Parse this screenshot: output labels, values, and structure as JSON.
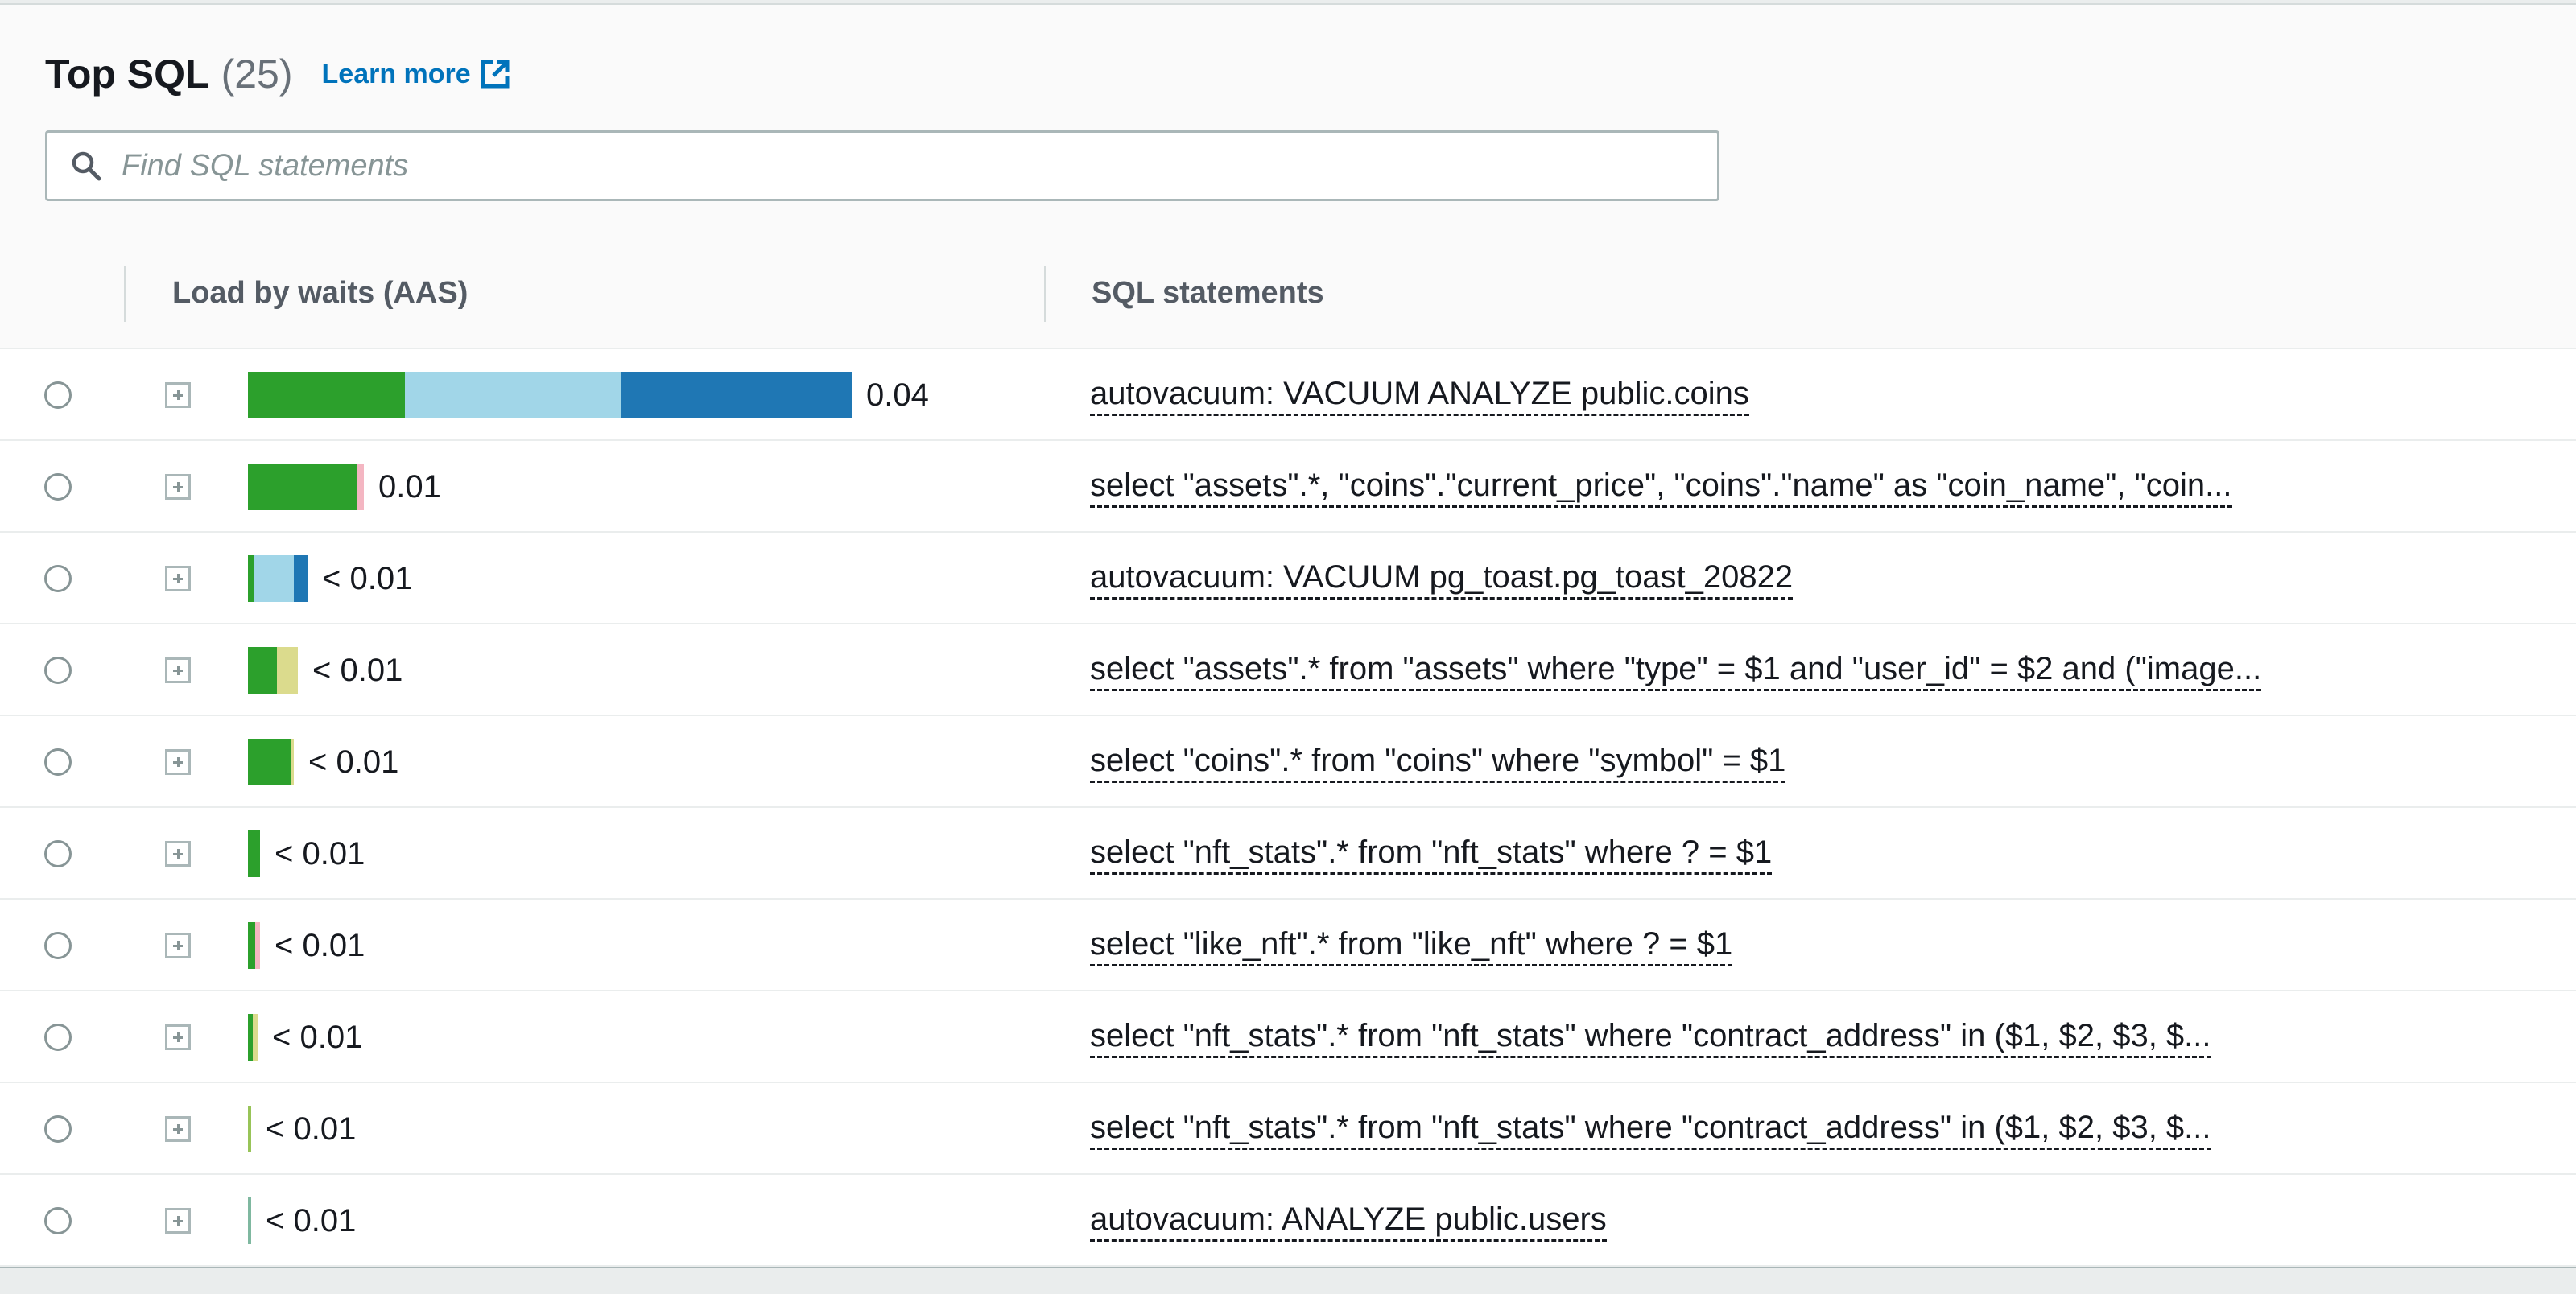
{
  "header": {
    "title": "Top SQL",
    "count": "(25)",
    "learn_more": "Learn more"
  },
  "search": {
    "placeholder": "Find SQL statements",
    "value": ""
  },
  "columns": {
    "load": "Load by waits (AAS)",
    "sql": "SQL statements"
  },
  "colors": {
    "cpu_green": "#2ca02c",
    "light_blue": "#a1d6e8",
    "dark_blue": "#1f77b4",
    "pink": "#f4b6c2",
    "pale_yellow": "#dbdb8d",
    "olive_green": "#98c458",
    "teal_green": "#7fb8a0"
  },
  "rows": [
    {
      "load": 0.04,
      "value_label": "0.04",
      "sql": "autovacuum: VACUUM ANALYZE public.coins",
      "segments": [
        {
          "color": "#2ca02c",
          "value": 0.0104
        },
        {
          "color": "#a1d6e8",
          "value": 0.0143
        },
        {
          "color": "#1f77b4",
          "value": 0.0153
        }
      ]
    },
    {
      "load": 0.01,
      "value_label": "0.01",
      "sql": "select \"assets\".*, \"coins\".\"current_price\", \"coins\".\"name\" as \"coin_name\", \"coin...",
      "segments": [
        {
          "color": "#2ca02c",
          "value": 0.0072
        },
        {
          "color": "#f4b6c2",
          "value": 0.0005
        }
      ]
    },
    {
      "load": 0.003,
      "value_label": "< 0.01",
      "sql": "autovacuum: VACUUM pg_toast.pg_toast_20822",
      "segments": [
        {
          "color": "#2ca02c",
          "value": 0.0004
        },
        {
          "color": "#a1d6e8",
          "value": 0.0026
        },
        {
          "color": "#1f77b4",
          "value": 0.0009
        }
      ]
    },
    {
      "load": 0.003,
      "value_label": "< 0.01",
      "sql": "select \"assets\".* from \"assets\" where \"type\" = $1 and \"user_id\" = $2 and (\"image...",
      "segments": [
        {
          "color": "#2ca02c",
          "value": 0.0019
        },
        {
          "color": "#dbdb8d",
          "value": 0.0014
        }
      ]
    },
    {
      "load": 0.003,
      "value_label": "< 0.01",
      "sql": "select \"coins\".* from \"coins\" where \"symbol\" = $1",
      "segments": [
        {
          "color": "#2ca02c",
          "value": 0.0028
        },
        {
          "color": "#dbdb8d",
          "value": 0.0002
        }
      ]
    },
    {
      "load": 0.001,
      "value_label": "< 0.01",
      "sql": "select \"nft_stats\".* from \"nft_stats\" where ? = $1",
      "segments": [
        {
          "color": "#2ca02c",
          "value": 0.0008
        }
      ]
    },
    {
      "load": 0.001,
      "value_label": "< 0.01",
      "sql": "select \"like_nft\".* from \"like_nft\" where ? = $1",
      "segments": [
        {
          "color": "#2ca02c",
          "value": 0.0005
        },
        {
          "color": "#f4b6c2",
          "value": 0.0003
        }
      ]
    },
    {
      "load": 0.001,
      "value_label": "< 0.01",
      "sql": "select \"nft_stats\".* from \"nft_stats\" where \"contract_address\" in ($1, $2, $3, $...",
      "segments": [
        {
          "color": "#2ca02c",
          "value": 0.0003
        },
        {
          "color": "#dbdb8d",
          "value": 0.0003
        }
      ]
    },
    {
      "load": 0.0003,
      "value_label": "< 0.01",
      "sql": "select \"nft_stats\".* from \"nft_stats\" where \"contract_address\" in ($1, $2, $3, $...",
      "segments": [
        {
          "color": "#98c458",
          "value": 0.0002
        }
      ]
    },
    {
      "load": 0.0003,
      "value_label": "< 0.01",
      "sql": "autovacuum: ANALYZE public.users",
      "segments": [
        {
          "color": "#7fb8a0",
          "value": 0.0002
        }
      ]
    }
  ]
}
